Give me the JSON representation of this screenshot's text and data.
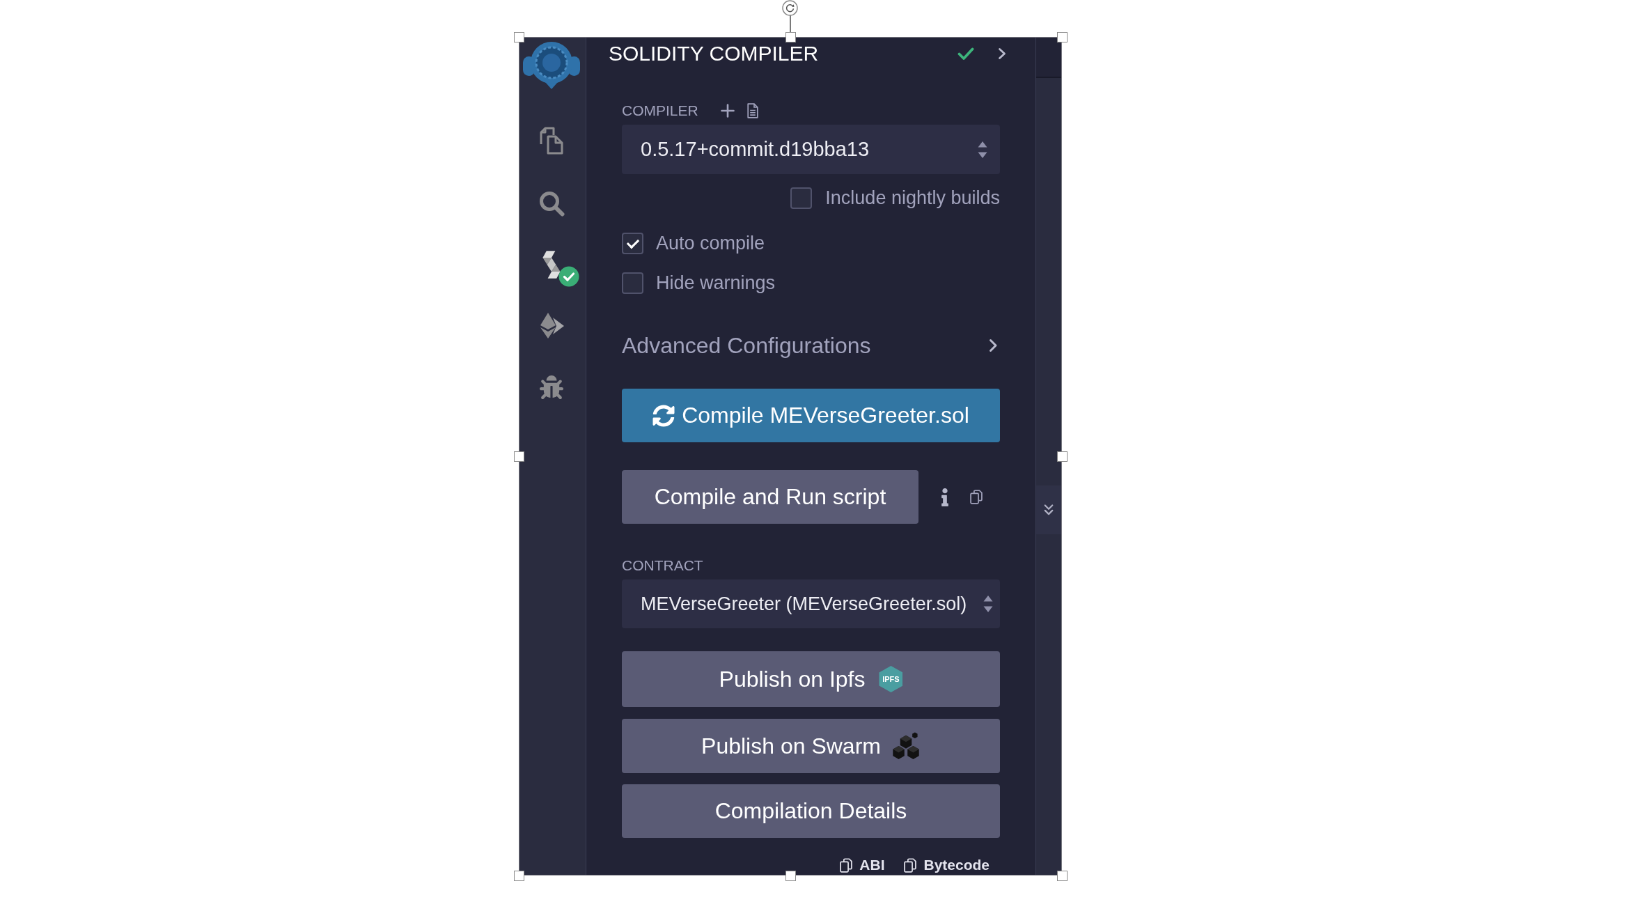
{
  "sidebar": {
    "items": [
      {
        "kind": "files",
        "badge": false
      },
      {
        "kind": "search",
        "badge": false
      },
      {
        "kind": "compiler",
        "badge": true
      },
      {
        "kind": "deploy",
        "badge": false
      },
      {
        "kind": "debugger",
        "badge": false
      }
    ]
  },
  "header": {
    "title": "SOLIDITY COMPILER",
    "compiled": true
  },
  "compiler": {
    "label": "COMPILER",
    "version": "0.5.17+commit.d19bba13",
    "nightly": {
      "label": "Include nightly builds",
      "checked": false
    },
    "options": [
      {
        "label": "Auto compile",
        "checked": true
      },
      {
        "label": "Hide warnings",
        "checked": false
      }
    ]
  },
  "advanced": {
    "label": "Advanced Configurations",
    "expanded": false
  },
  "compile_button": {
    "label": "Compile MEVerseGreeter.sol"
  },
  "run_script": {
    "label": "Compile and Run script"
  },
  "contract": {
    "label": "CONTRACT",
    "value": "MEVerseGreeter (MEVerseGreeter.sol)"
  },
  "actions": [
    {
      "kind": "ipfs",
      "label": "Publish on Ipfs",
      "logo_text": "IPFS"
    },
    {
      "kind": "swarm",
      "label": "Publish on Swarm"
    },
    {
      "kind": "plain",
      "label": "Compilation Details"
    }
  ],
  "copy_links": [
    {
      "label": "ABI"
    },
    {
      "label": "Bytecode"
    }
  ]
}
